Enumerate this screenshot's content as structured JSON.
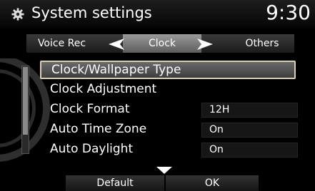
{
  "header": {
    "title": "System settings",
    "time": "9:30"
  },
  "tabs": {
    "left": "Voice Rec",
    "active": "Clock",
    "right": "Others"
  },
  "menu": [
    {
      "label": "Clock/Wallpaper Type",
      "value": null,
      "selected": true
    },
    {
      "label": "Clock Adjustment",
      "value": null,
      "selected": false
    },
    {
      "label": "Clock Format",
      "value": "12H",
      "selected": false
    },
    {
      "label": "Auto Time Zone",
      "value": "On",
      "selected": false
    },
    {
      "label": "Auto Daylight",
      "value": "On",
      "selected": false
    }
  ],
  "footer": {
    "default_label": "Default",
    "ok_label": "OK"
  },
  "icons": {
    "header": "gear-icon",
    "tab_prev": "left-arrow-icon",
    "tab_next": "right-arrow-icon",
    "scroll_more": "down-arrow-icon"
  },
  "colors": {
    "selected_border": "#d8d0b0",
    "active_tab": "#8a8a8a"
  }
}
